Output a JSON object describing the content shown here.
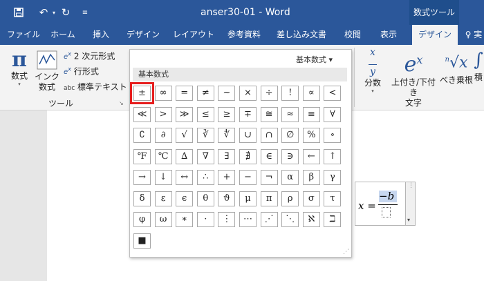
{
  "titlebar": {
    "doc_title": "anser30-01  -  Word",
    "context_tools": "数式ツール"
  },
  "tabs": [
    "ファイル",
    "ホーム",
    "挿入",
    "デザイン",
    "レイアウト",
    "参考資料",
    "差し込み文書",
    "校閲",
    "表示",
    "デザイン",
    "♀ 実"
  ],
  "ribbon": {
    "equation": "数式",
    "ink1": "インク",
    "ink2": "数式",
    "professional": "2 次元形式",
    "linear": "行形式",
    "normal_text": "標準テキスト",
    "group_tools": "ツール",
    "fraction": "分数",
    "script1": "上付き/下付き",
    "script2": "文字",
    "radical": "べき乗根",
    "integral": "積"
  },
  "gallery": {
    "dropdown": "基本数式 ▾",
    "section": "基本数式",
    "rows": [
      [
        "±",
        "∞",
        "=",
        "≠",
        "~",
        "×",
        "÷",
        "!",
        "∝",
        "<"
      ],
      [
        "≪",
        ">",
        "≫",
        "≤",
        "≥",
        "∓",
        "≅",
        "≈",
        "≡",
        "∀"
      ],
      [
        "∁",
        "∂",
        "√",
        "∛",
        "∜",
        "∪",
        "∩",
        "∅",
        "%",
        "∘"
      ],
      [
        "℉",
        "℃",
        "∆",
        "∇",
        "∃",
        "∄",
        "∈",
        "∋",
        "←",
        "↑"
      ],
      [
        "→",
        "↓",
        "↔",
        "∴",
        "+",
        "−",
        "¬",
        "α",
        "β",
        "γ"
      ],
      [
        "δ",
        "ε",
        "ϵ",
        "θ",
        "ϑ",
        "μ",
        "π",
        "ρ",
        "σ",
        "τ"
      ],
      [
        "φ",
        "ω",
        "∗",
        "·",
        "⋮",
        "⋯",
        "⋰",
        "⋱",
        "ℵ",
        "ℶ"
      ],
      [
        "■"
      ]
    ]
  },
  "equation": {
    "lhs": "x =",
    "numerator": "−b"
  },
  "colors": {
    "accent": "#2b579a",
    "highlight": "#e61e1e"
  }
}
